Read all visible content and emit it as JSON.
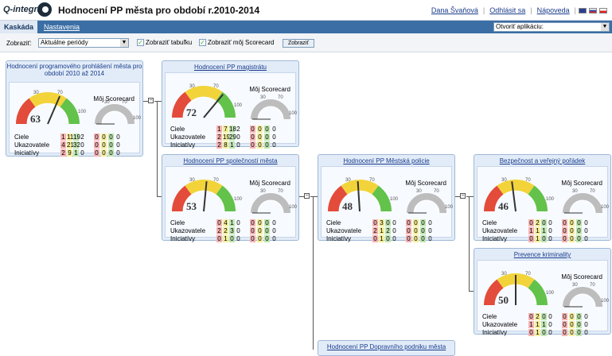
{
  "header": {
    "logo": "Q-integra",
    "title": "Hodnocení PP města pro období r.2010-2014",
    "links": [
      "Dana Švaňová",
      "Odhlásit sa",
      "Nápoveda"
    ]
  },
  "nav": {
    "tab_active": "Kaskáda",
    "tab_other": "Nastavenia",
    "app_select": "Otvoriť aplikáciu:"
  },
  "toolbar": {
    "label": "Zobraziť:",
    "period": "Aktuálne periódy",
    "check1": "Zobraziť tabuľku",
    "check2": "Zobraziť môj Scorecard",
    "button": "Zobraziť"
  },
  "row_labels": [
    "Ciele",
    "Ukazovatele",
    "Iniciatívy"
  ],
  "my_scorecard": "Môj Scorecard",
  "gauge_ticks": [
    "30",
    "70",
    "100"
  ],
  "cards": [
    {
      "title": "Hodnocení programového prohlášení města pro období 2010 až 2014",
      "score": "63",
      "score_level": 63,
      "main": [
        [
          "1",
          "11",
          "19",
          "2"
        ],
        [
          "4",
          "21",
          "32",
          "0"
        ],
        [
          "2",
          "9",
          "1",
          "0"
        ]
      ],
      "mine": [
        [
          "0",
          "0",
          "0",
          "0"
        ],
        [
          "0",
          "0",
          "0",
          "0"
        ],
        [
          "0",
          "0",
          "0",
          "0"
        ]
      ]
    },
    {
      "title": "Hodnocení PP magistrátu",
      "score": "72",
      "score_level": 72,
      "main": [
        [
          "1",
          "7",
          "18",
          "2"
        ],
        [
          "2",
          "19",
          "29",
          "0"
        ],
        [
          "2",
          "8",
          "1",
          "0"
        ]
      ],
      "mine": [
        [
          "0",
          "0",
          "0",
          "0"
        ],
        [
          "0",
          "0",
          "0",
          "0"
        ],
        [
          "0",
          "0",
          "0",
          "0"
        ]
      ]
    },
    {
      "title": "Hodnocení PP společností města",
      "score": "53",
      "score_level": 53,
      "main": [
        [
          "0",
          "4",
          "1",
          "0"
        ],
        [
          "2",
          "2",
          "3",
          "0"
        ],
        [
          "0",
          "1",
          "0",
          "0"
        ]
      ],
      "mine": [
        [
          "0",
          "0",
          "0",
          "0"
        ],
        [
          "0",
          "0",
          "0",
          "0"
        ],
        [
          "0",
          "0",
          "0",
          "0"
        ]
      ]
    },
    {
      "title": "Hodnocení PP Městská policie",
      "score": "48",
      "score_level": 48,
      "main": [
        [
          "0",
          "3",
          "0",
          "0"
        ],
        [
          "2",
          "1",
          "2",
          "0"
        ],
        [
          "0",
          "1",
          "0",
          "0"
        ]
      ],
      "mine": [
        [
          "0",
          "0",
          "0",
          "0"
        ],
        [
          "0",
          "0",
          "0",
          "0"
        ],
        [
          "0",
          "0",
          "0",
          "0"
        ]
      ]
    },
    {
      "title": "Bezpečnost a veřejný pořádek",
      "score": "46",
      "score_level": 46,
      "main": [
        [
          "0",
          "2",
          "0",
          "0"
        ],
        [
          "1",
          "1",
          "1",
          "0"
        ],
        [
          "0",
          "1",
          "0",
          "0"
        ]
      ],
      "mine": [
        [
          "0",
          "0",
          "0",
          "0"
        ],
        [
          "0",
          "0",
          "0",
          "0"
        ],
        [
          "0",
          "0",
          "0",
          "0"
        ]
      ]
    },
    {
      "title": "Prevence kriminality",
      "score": "50",
      "score_level": 50,
      "main": [
        [
          "0",
          "2",
          "0",
          "0"
        ],
        [
          "1",
          "1",
          "1",
          "0"
        ],
        [
          "0",
          "1",
          "0",
          "0"
        ]
      ],
      "mine": [
        [
          "0",
          "0",
          "0",
          "0"
        ],
        [
          "0",
          "0",
          "0",
          "0"
        ],
        [
          "0",
          "0",
          "0",
          "0"
        ]
      ]
    },
    {
      "title": "Hodnocení PP Dopravního podniku města"
    }
  ]
}
